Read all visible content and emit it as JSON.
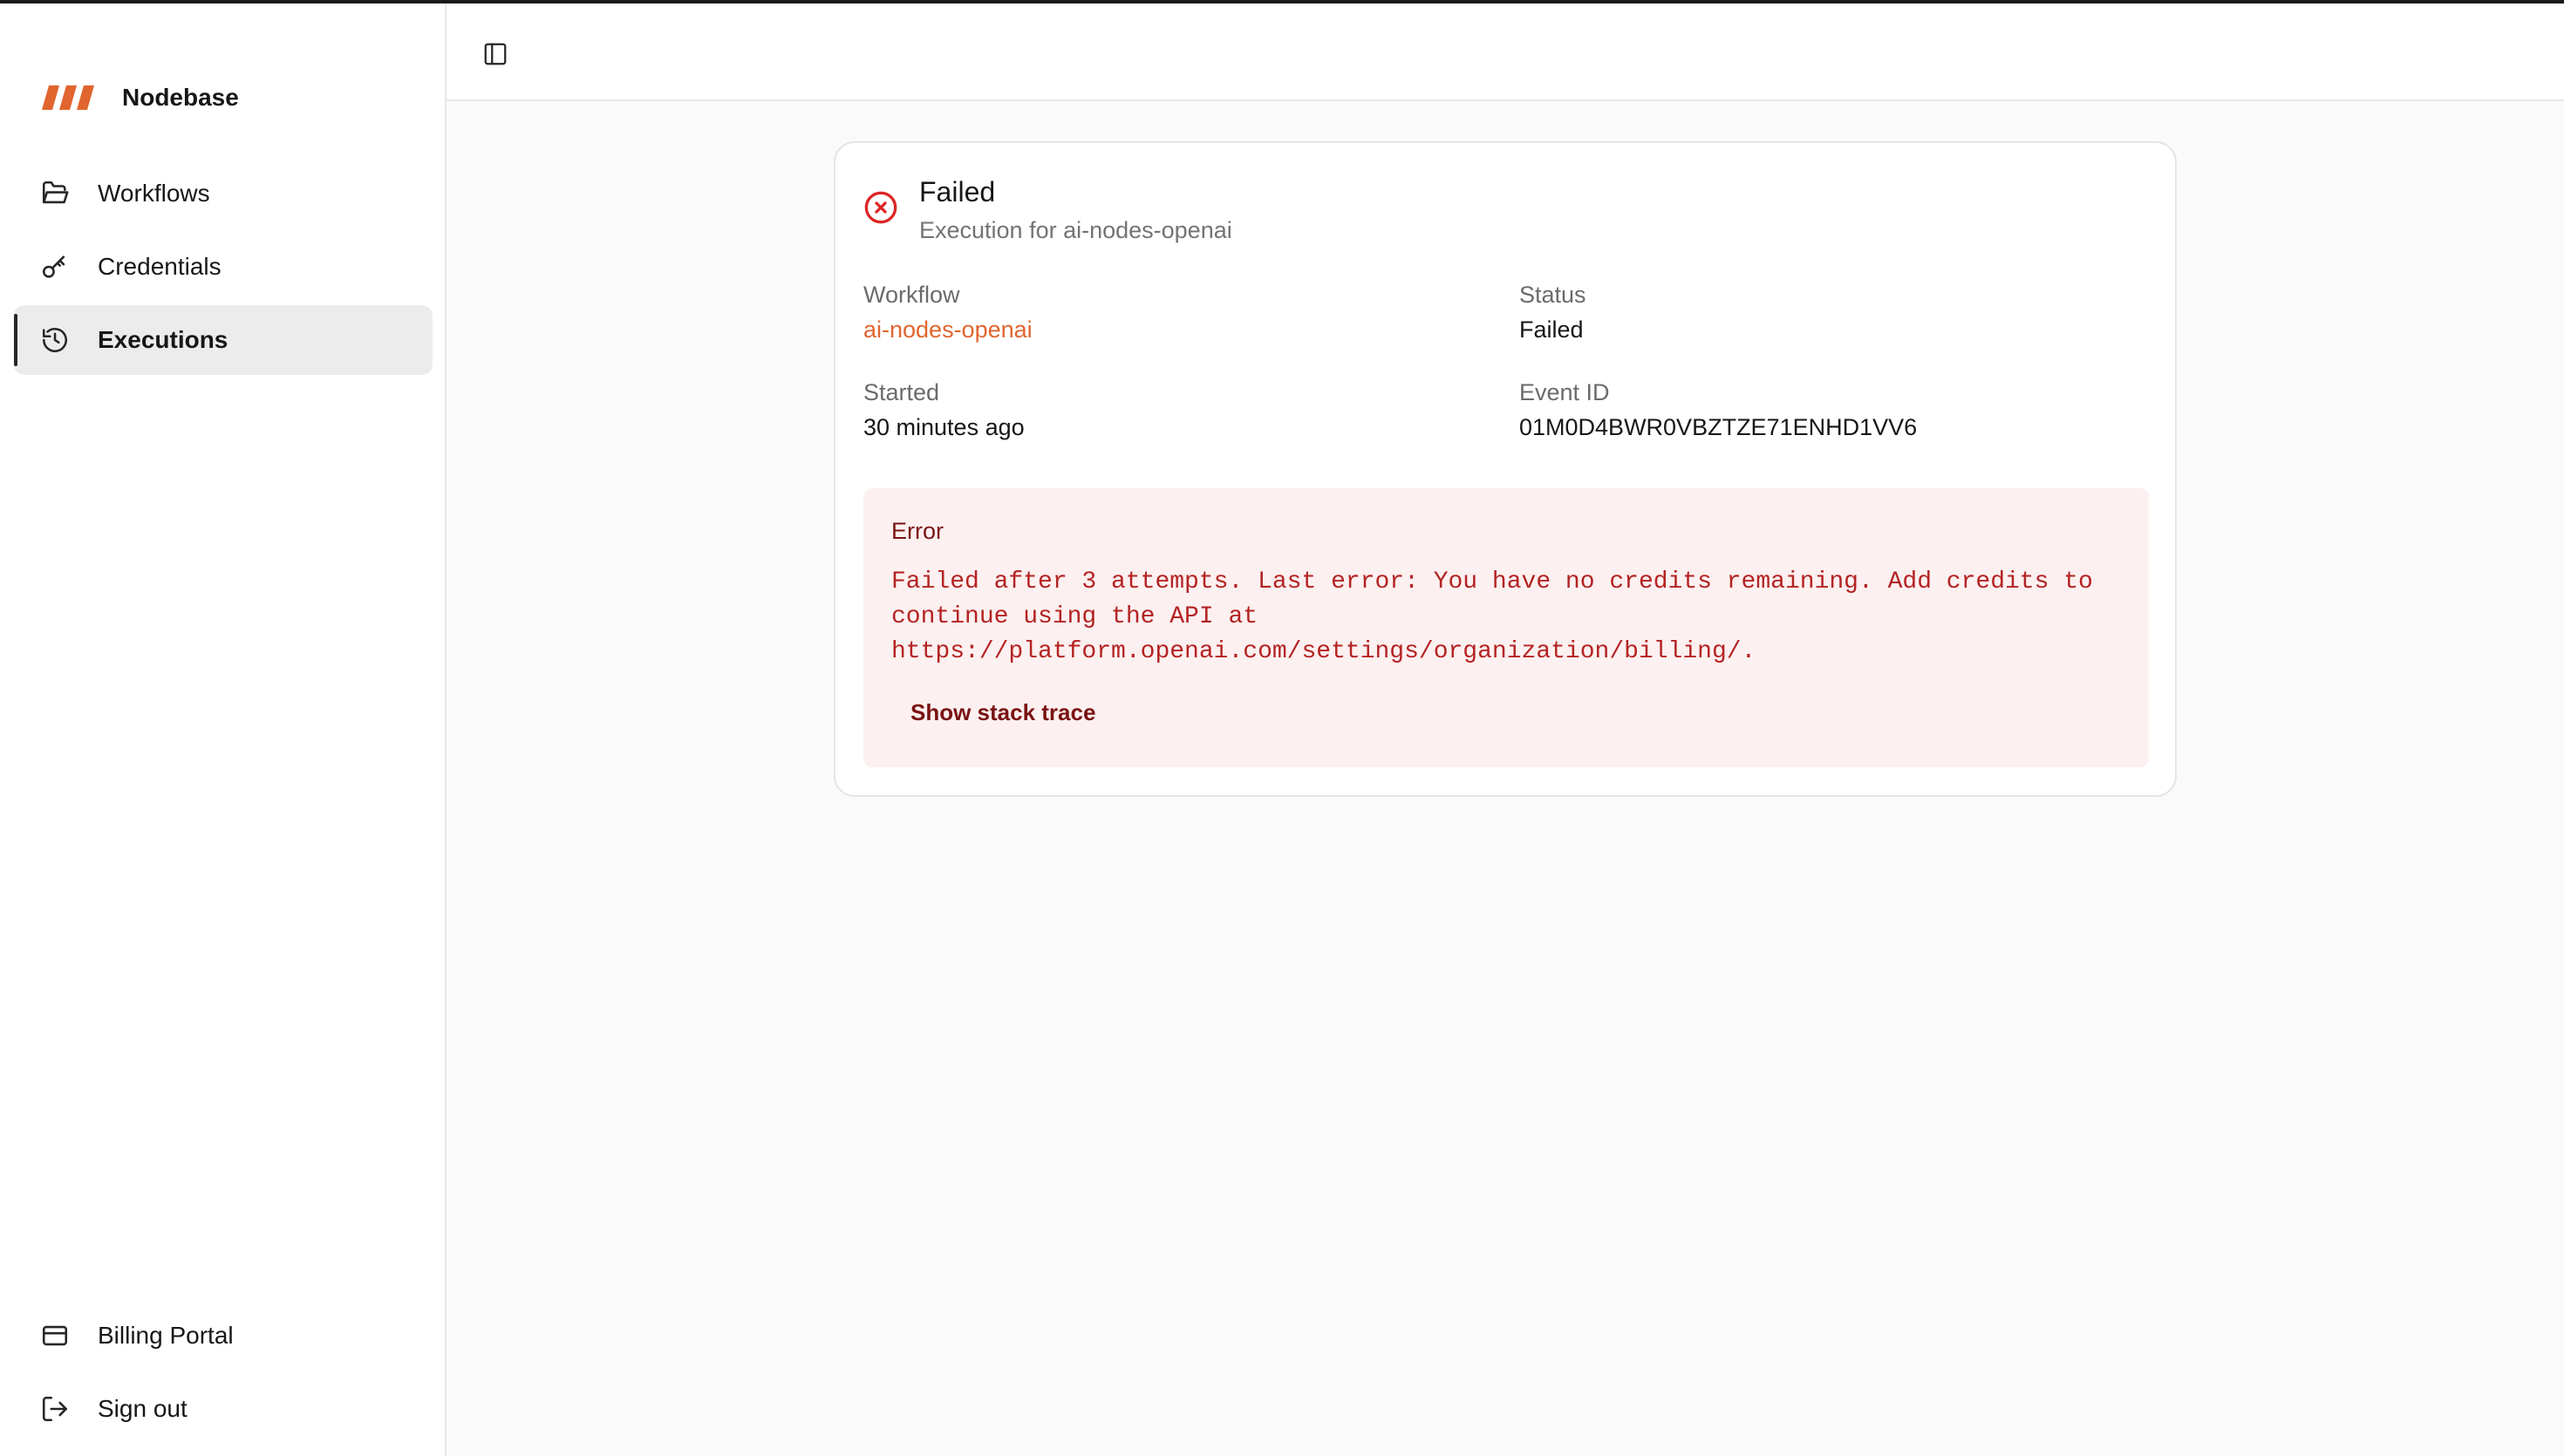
{
  "brand": {
    "name": "Nodebase",
    "logo_icon": "stripes-logo-icon",
    "accent_color": "#e0652e"
  },
  "sidebar": {
    "items": [
      {
        "label": "Workflows",
        "icon": "folder-open-icon",
        "active": false
      },
      {
        "label": "Credentials",
        "icon": "key-icon",
        "active": false
      },
      {
        "label": "Executions",
        "icon": "history-icon",
        "active": true
      }
    ],
    "bottom_items": [
      {
        "label": "Billing Portal",
        "icon": "credit-card-icon"
      },
      {
        "label": "Sign out",
        "icon": "log-out-icon"
      }
    ]
  },
  "header": {
    "toggle_icon": "sidebar-toggle-icon"
  },
  "execution": {
    "status_icon": "x-circle-icon",
    "title": "Failed",
    "subtitle": "Execution for ai-nodes-openai",
    "fields": {
      "workflow_label": "Workflow",
      "workflow_value": "ai-nodes-openai",
      "status_label": "Status",
      "status_value": "Failed",
      "started_label": "Started",
      "started_value": "30 minutes ago",
      "event_id_label": "Event ID",
      "event_id_value": "01M0D4BWR0VBZTZE71ENHD1VV6"
    },
    "error": {
      "label": "Error",
      "message": "Failed after 3 attempts. Last error: You have no credits remaining. Add credits to\ncontinue using the API at\nhttps://platform.openai.com/settings/organization/billing/.",
      "stack_trace_label": "Show stack trace"
    },
    "colors": {
      "error_bg": "#fdf0f0",
      "error_text": "#b42323",
      "fail_icon": "#dc2626"
    }
  }
}
